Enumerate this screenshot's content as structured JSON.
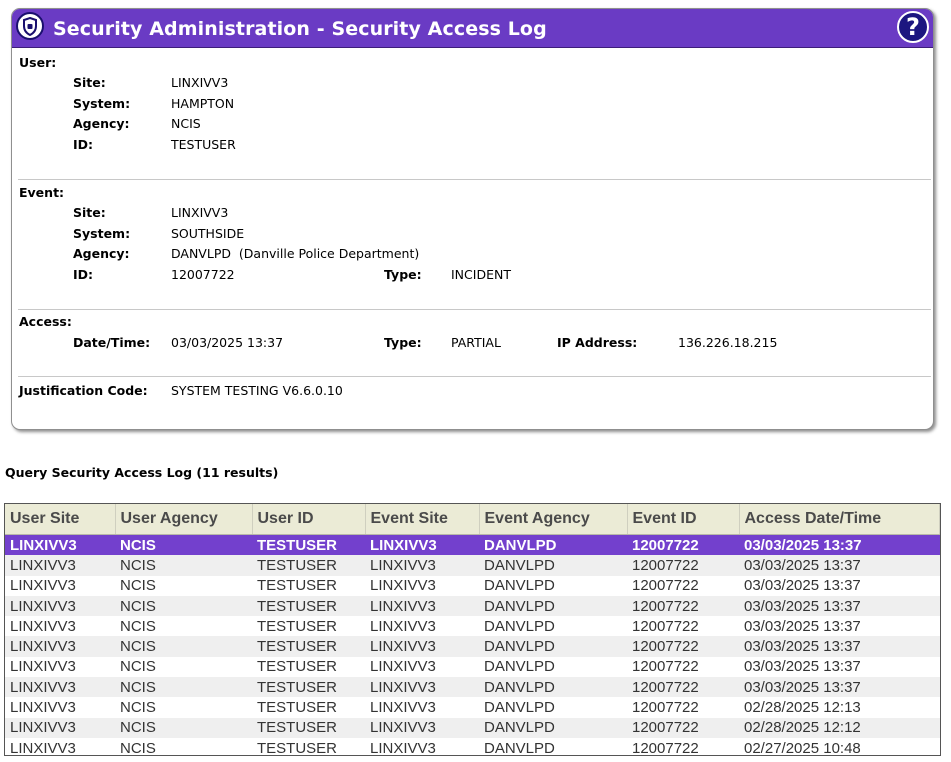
{
  "header": {
    "title": "Security Administration - Security Access Log",
    "help_label": "?"
  },
  "user": {
    "section_label": "User:",
    "site_label": "Site:",
    "site": "LINXIVV3",
    "system_label": "System:",
    "system": "HAMPTON",
    "agency_label": "Agency:",
    "agency": "NCIS",
    "id_label": "ID:",
    "id": "TESTUSER"
  },
  "event": {
    "section_label": "Event:",
    "site_label": "Site:",
    "site": "LINXIVV3",
    "system_label": "System:",
    "system": "SOUTHSIDE",
    "agency_label": "Agency:",
    "agency": "DANVLPD  (Danville Police Department)",
    "id_label": "ID:",
    "id": "12007722",
    "type_label": "Type:",
    "type": "INCIDENT"
  },
  "access": {
    "section_label": "Access:",
    "datetime_label": "Date/Time:",
    "datetime": "03/03/2025 13:37",
    "type_label": "Type:",
    "type": "PARTIAL",
    "ip_label": "IP Address:",
    "ip": "136.226.18.215"
  },
  "justification": {
    "label": "Justification Code:",
    "value": "SYSTEM TESTING V6.6.0.10"
  },
  "query": {
    "title": "Query Security Access Log (11 results)",
    "columns": [
      "User Site",
      "User Agency",
      "User ID",
      "Event Site",
      "Event Agency",
      "Event ID",
      "Access Date/Time"
    ],
    "rows": [
      [
        "LINXIVV3",
        "NCIS",
        "TESTUSER",
        "LINXIVV3",
        "DANVLPD",
        "12007722",
        "03/03/2025 13:37"
      ],
      [
        "LINXIVV3",
        "NCIS",
        "TESTUSER",
        "LINXIVV3",
        "DANVLPD",
        "12007722",
        "03/03/2025 13:37"
      ],
      [
        "LINXIVV3",
        "NCIS",
        "TESTUSER",
        "LINXIVV3",
        "DANVLPD",
        "12007722",
        "03/03/2025 13:37"
      ],
      [
        "LINXIVV3",
        "NCIS",
        "TESTUSER",
        "LINXIVV3",
        "DANVLPD",
        "12007722",
        "03/03/2025 13:37"
      ],
      [
        "LINXIVV3",
        "NCIS",
        "TESTUSER",
        "LINXIVV3",
        "DANVLPD",
        "12007722",
        "03/03/2025 13:37"
      ],
      [
        "LINXIVV3",
        "NCIS",
        "TESTUSER",
        "LINXIVV3",
        "DANVLPD",
        "12007722",
        "03/03/2025 13:37"
      ],
      [
        "LINXIVV3",
        "NCIS",
        "TESTUSER",
        "LINXIVV3",
        "DANVLPD",
        "12007722",
        "03/03/2025 13:37"
      ],
      [
        "LINXIVV3",
        "NCIS",
        "TESTUSER",
        "LINXIVV3",
        "DANVLPD",
        "12007722",
        "03/03/2025 13:37"
      ],
      [
        "LINXIVV3",
        "NCIS",
        "TESTUSER",
        "LINXIVV3",
        "DANVLPD",
        "12007722",
        "02/28/2025 12:13"
      ],
      [
        "LINXIVV3",
        "NCIS",
        "TESTUSER",
        "LINXIVV3",
        "DANVLPD",
        "12007722",
        "02/28/2025 12:12"
      ],
      [
        "LINXIVV3",
        "NCIS",
        "TESTUSER",
        "LINXIVV3",
        "DANVLPD",
        "12007722",
        "02/27/2025 10:48"
      ]
    ],
    "selected_row": 0
  },
  "colors": {
    "accent": "#6a3bc4",
    "selected_row": "#7340cd",
    "header_bg": "#ebebd6"
  },
  "icons": {
    "logo": "shield-icon",
    "help": "help-icon"
  }
}
